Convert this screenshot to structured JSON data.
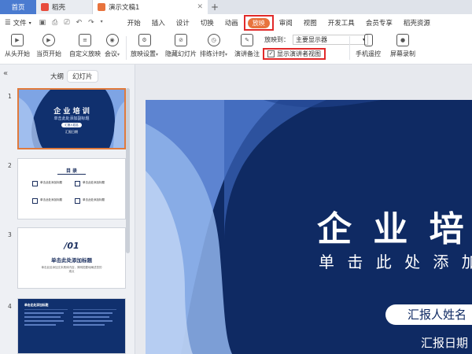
{
  "tabs": {
    "home": "首页",
    "wps": "稻壳",
    "doc": "演示文稿1",
    "add": "+"
  },
  "menu": {
    "file": "文件",
    "ribbon": [
      "开始",
      "插入",
      "设计",
      "切换",
      "动画",
      "放映",
      "审阅",
      "视图",
      "开发工具",
      "会员专享",
      "稻壳资源"
    ],
    "active": "放映"
  },
  "toolbar": {
    "from_start": "从头开始",
    "from_current": "当页开始",
    "custom_show": "自定义放映",
    "meeting": "会议",
    "show_settings": "放映设置",
    "hide_slide": "隐藏幻灯片",
    "rehearse": "排练计时",
    "speaker_notes": "演讲备注",
    "screen_to_label": "放映到：",
    "screen_to_value": "主要显示器",
    "presenter_view": "显示演讲者视图",
    "phone_control": "手机遥控",
    "screen_record": "屏幕录制"
  },
  "panel": {
    "outline": "大纲",
    "slides": "幻灯片",
    "slide_numbers": [
      "1",
      "2",
      "3",
      "4"
    ]
  },
  "thumb1": {
    "title": "企 业 培 训",
    "subtitle": "单击此处添加副标题",
    "reporter": "汇报人姓名",
    "date": "汇报日期"
  },
  "thumb2": {
    "title": "目 录",
    "item": "单击此处添加标题"
  },
  "thumb3": {
    "num": "/01",
    "title": "单击此处添加标题",
    "body": "单击此处添加文本具体内容，简明扼要地阐述您的观点"
  },
  "thumb4": {
    "title": "单击此处添加标题"
  },
  "slide": {
    "title": "企 业 培",
    "subtitle": "单 击 此 处 添 加",
    "reporter": "汇报人姓名",
    "date": "汇报日期"
  },
  "colors": {
    "active_tab": "#e8733d",
    "highlight": "#e12a2a",
    "slide_bg": "#0f2a63",
    "slide_light": "#8fb3ea"
  }
}
